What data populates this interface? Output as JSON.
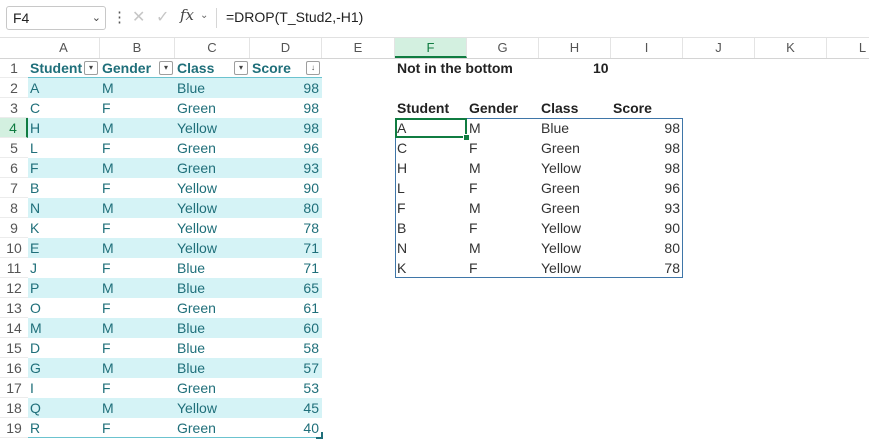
{
  "formula_bar": {
    "name_box": "F4",
    "name_box_arrow": "⌄",
    "more_icon": "⋮",
    "cancel_icon": "✕",
    "enter_icon": "✓",
    "fx_label": "fx",
    "fx_arrow": "⌄",
    "formula": "=DROP(T_Stud2,-H1)"
  },
  "columns": [
    "A",
    "B",
    "C",
    "D",
    "E",
    "F",
    "G",
    "H",
    "I",
    "J",
    "K",
    "L"
  ],
  "selected_column": "F",
  "rows": [
    "1",
    "2",
    "3",
    "4",
    "5",
    "6",
    "7",
    "8",
    "9",
    "10",
    "11",
    "12",
    "13",
    "14",
    "15",
    "16",
    "17",
    "18",
    "19"
  ],
  "selected_row": "4",
  "table": {
    "headers": [
      "Student",
      "Gender",
      "Class",
      "Score"
    ],
    "header_icons": [
      "filter-dropdown-icon",
      "filter-dropdown-icon",
      "filter-dropdown-icon",
      "sorted-descending-icon"
    ],
    "header_icon_glyphs": [
      "▾",
      "▾",
      "▾",
      "↓"
    ],
    "rows": [
      [
        "A",
        "M",
        "Blue",
        "98"
      ],
      [
        "C",
        "F",
        "Green",
        "98"
      ],
      [
        "H",
        "M",
        "Yellow",
        "98"
      ],
      [
        "L",
        "F",
        "Green",
        "96"
      ],
      [
        "F",
        "M",
        "Green",
        "93"
      ],
      [
        "B",
        "F",
        "Yellow",
        "90"
      ],
      [
        "N",
        "M",
        "Yellow",
        "80"
      ],
      [
        "K",
        "F",
        "Yellow",
        "78"
      ],
      [
        "E",
        "M",
        "Yellow",
        "71"
      ],
      [
        "J",
        "F",
        "Blue",
        "71"
      ],
      [
        "P",
        "M",
        "Blue",
        "65"
      ],
      [
        "O",
        "F",
        "Green",
        "61"
      ],
      [
        "M",
        "M",
        "Blue",
        "60"
      ],
      [
        "D",
        "F",
        "Blue",
        "58"
      ],
      [
        "G",
        "M",
        "Blue",
        "57"
      ],
      [
        "I",
        "F",
        "Green",
        "53"
      ],
      [
        "Q",
        "M",
        "Yellow",
        "45"
      ],
      [
        "R",
        "F",
        "Green",
        "40"
      ]
    ]
  },
  "param": {
    "label": "Not in the bottom",
    "value": "10"
  },
  "result": {
    "headers": [
      "Student",
      "Gender",
      "Class",
      "Score"
    ],
    "rows": [
      [
        "A",
        "M",
        "Blue",
        "98"
      ],
      [
        "C",
        "F",
        "Green",
        "98"
      ],
      [
        "H",
        "M",
        "Yellow",
        "98"
      ],
      [
        "L",
        "F",
        "Green",
        "96"
      ],
      [
        "F",
        "M",
        "Green",
        "93"
      ],
      [
        "B",
        "F",
        "Yellow",
        "90"
      ],
      [
        "N",
        "M",
        "Yellow",
        "80"
      ],
      [
        "K",
        "F",
        "Yellow",
        "78"
      ]
    ]
  },
  "colors": {
    "table_band": "#d5f3f6",
    "table_text": "#1f6f7a",
    "selection_green": "#107c41",
    "spill_border": "#3f76a8"
  }
}
